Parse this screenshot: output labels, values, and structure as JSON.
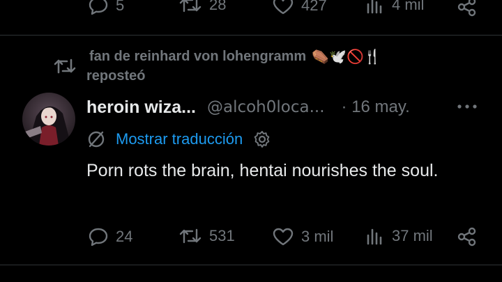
{
  "prev_tweet": {
    "actions": {
      "replies": "5",
      "reposts": "28",
      "likes": "427",
      "views": "4 mil"
    }
  },
  "repost_header": {
    "text": "fan de reinhard von lohengramm",
    "emojis": "⚰️🕊️🚫🍴",
    "verb": "reposteó"
  },
  "tweet": {
    "display_name": "heroin wiza...",
    "handle": "@alcoh0loca...",
    "date": "· 16 may.",
    "translate_label": "Mostrar traducción",
    "text": "Porn rots the brain, hentai nourishes the soul.",
    "actions": {
      "replies": "24",
      "reposts": "531",
      "likes": "3 mil",
      "views": "37 mil"
    }
  },
  "colors": {
    "background": "#000000",
    "text": "#e7e9ea",
    "muted": "#71767b",
    "link": "#1d9bf0",
    "divider": "#2f3336"
  }
}
